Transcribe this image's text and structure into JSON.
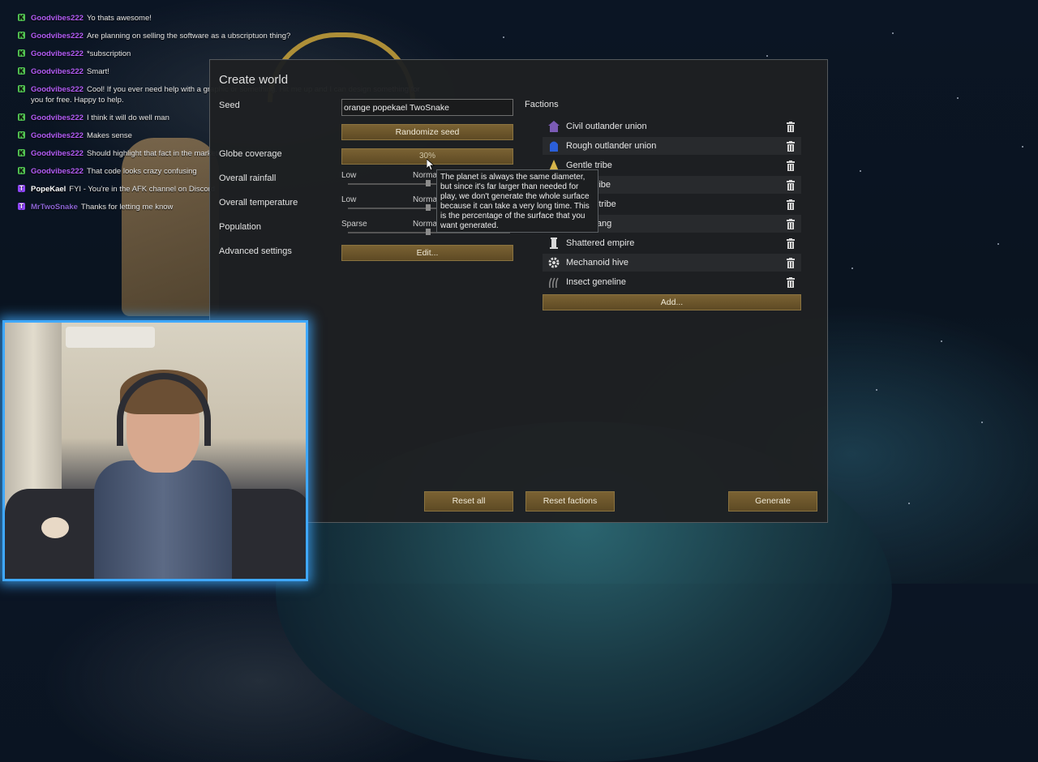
{
  "chat": {
    "messages": [
      {
        "user": "Goodvibes222",
        "text": "Yo thats awesome!",
        "badge": "K"
      },
      {
        "user": "Goodvibes222",
        "text": "Are planning on selling the software as a ubscriptuon thing?",
        "badge": "K"
      },
      {
        "user": "Goodvibes222",
        "text": "*subscription",
        "badge": "K"
      },
      {
        "user": "Goodvibes222",
        "text": "Smart!",
        "badge": "K"
      },
      {
        "user": "Goodvibes222",
        "text": "Cool! If you ever need help with a graphic or something. Hit me up and I can design something for you for free. Happy to help.",
        "badge": "K"
      },
      {
        "user": "Goodvibes222",
        "text": "I think it will do well man",
        "badge": "K"
      },
      {
        "user": "Goodvibes222",
        "text": "Makes sense",
        "badge": "K"
      },
      {
        "user": "Goodvibes222",
        "text": "Should highlight that fact in the marketing",
        "badge": "K"
      },
      {
        "user": "Goodvibes222",
        "text": "That code looks crazy confusing",
        "badge": "K"
      },
      {
        "user": "PopeKael",
        "text": "FYI - You're in the AFK channel on Discord",
        "badge": "T"
      },
      {
        "user": "MrTwoSnake",
        "text": "Thanks for letting me know",
        "badge": "T"
      }
    ]
  },
  "dialog": {
    "title": "Create world",
    "seed_label": "Seed",
    "seed_value": "orange popekael TwoSnake",
    "randomize_label": "Randomize seed",
    "globe_coverage_label": "Globe coverage",
    "globe_coverage_value": "30%",
    "globe_coverage_fraction": 0.3,
    "rainfall_label": "Overall rainfall",
    "rainfall_min": "Low",
    "rainfall_mid": "Normal",
    "temperature_label": "Overall temperature",
    "temperature_min": "Low",
    "temperature_mid": "Normal",
    "population_label": "Population",
    "population_min": "Sparse",
    "population_mid": "Normal",
    "advanced_label": "Advanced settings",
    "edit_label": "Edit...",
    "factions_label": "Factions",
    "factions": [
      {
        "name": "Civil outlander union",
        "icon": "house-icon",
        "color": "#7b5bb5"
      },
      {
        "name": "Rough outlander union",
        "icon": "helmet-icon",
        "color": "#2b5fd9"
      },
      {
        "name": "Gentle tribe",
        "icon": "triangle-icon",
        "color": "#d6b44a"
      },
      {
        "name": "Fierce tribe",
        "icon": "flame-icon",
        "color": "#c2643a"
      },
      {
        "name": "Savage tribe",
        "icon": "skull-icon",
        "color": "#b03a3a"
      },
      {
        "name": "Pirate gang",
        "icon": "skull-icon",
        "color": "#9a9a9a"
      },
      {
        "name": "Shattered empire",
        "icon": "pillar-icon",
        "color": "#d8d8d8"
      },
      {
        "name": "Mechanoid hive",
        "icon": "gear-icon",
        "color": "#d8d8d8"
      },
      {
        "name": "Insect geneline",
        "icon": "claws-icon",
        "color": "#8a8a8a"
      }
    ],
    "add_label": "Add...",
    "tooltip": "The planet is always the same diameter, but since it's far larger than needed for play, we don't generate the whole surface because it can take a very long time. This is the percentage of the surface that you want generated.",
    "reset_all_label": "Reset all",
    "reset_factions_label": "Reset factions",
    "generate_label": "Generate"
  },
  "colors": {
    "button": "#6b5529",
    "dialog_bg": "#1e2022",
    "webcam_border": "#3fa8ff",
    "chat_user": "#b35cf5"
  }
}
